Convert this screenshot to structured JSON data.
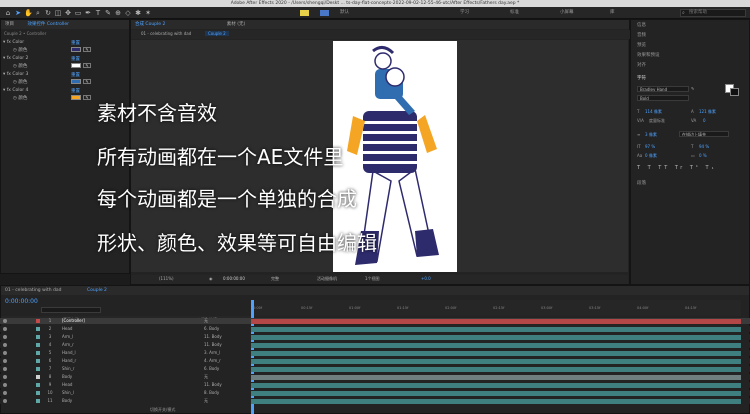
{
  "titlebar": {
    "text": "Adobe After Effects 2020 - /Users/shengqi/Deskt ... ts-day-flat-concepts-2022-09-02-12-55-46-utc/After Effects/Fathers day.aep *"
  },
  "toolbar": {
    "workspaces": [
      "默认",
      "学习",
      "标准",
      "小屏幕",
      "库"
    ],
    "active_workspace": "默认",
    "search_placeholder": "搜索帮助"
  },
  "effect_controls": {
    "tabs": [
      "项目",
      "效果控件 Controller"
    ],
    "breadcrumb": "Couple 2 • Controller",
    "groups": [
      {
        "name": "Color",
        "sub": "颜色",
        "reset": "重置",
        "color": "#2e2b6d"
      },
      {
        "name": "Color 2",
        "sub": "颜色",
        "reset": "重置",
        "color": "#ffffff"
      },
      {
        "name": "Color 3",
        "sub": "颜色",
        "reset": "重置",
        "color": "#2f6db0"
      },
      {
        "name": "Color 4",
        "sub": "颜色",
        "reset": "重置",
        "color": "#f5a524"
      }
    ]
  },
  "composition": {
    "tabs": [
      "合成 Couple 2",
      "素材 (无)"
    ],
    "breadcrumb": [
      "01 - celebrating with dad",
      "Couple 2"
    ],
    "zoom": "(111%)",
    "timecode": "0:00:00:00",
    "resolution": "完整",
    "camera": "活动摄像机",
    "views": "1个视图",
    "offset": "+0.0"
  },
  "overlay_lines": [
    "素材不含音效",
    "所有动画都在一个AE文件里",
    "每个动画都是一个单独的合成",
    "形状、颜色、效果等可自由编辑"
  ],
  "right_panels": {
    "items": [
      "信息",
      "音频",
      "预览",
      "效果和预设",
      "对齐"
    ],
    "character": {
      "title": "字符",
      "font": "Bradley Hand",
      "style": "Bold",
      "size": "114 像素",
      "leading": "121 像素",
      "kerning": "度量标准",
      "tracking": "0",
      "stroke": "3 像素",
      "stroke_mode": "在描边上填充",
      "vscale": "97 %",
      "hscale": "94 %",
      "baseline": "0 像素",
      "tsume": "0 %"
    },
    "paragraph": "段落"
  },
  "timeline": {
    "tabs": [
      "01 - celebrating with dad",
      "Couple 2"
    ],
    "timecode": "0:00:00:00",
    "col_source": "图层名称",
    "col_parent": "父级和链接",
    "ruler_ticks": [
      "0:00f",
      "00:15f",
      "01:00f",
      "01:15f",
      "02:00f",
      "02:15f",
      "03:00f",
      "03:15f",
      "04:00f",
      "04:15f"
    ],
    "footer": "切换开关/模式",
    "layers": [
      {
        "num": "1",
        "name": "[Controller]",
        "parent": "无",
        "color": "#c24a4a",
        "bar": "#b34747"
      },
      {
        "num": "2",
        "name": "Head",
        "parent": "6. Body",
        "color": "#5fa8a8",
        "bar": "#3f7f7f"
      },
      {
        "num": "3",
        "name": "Arm_l",
        "parent": "11. Body",
        "color": "#5fa8a8",
        "bar": "#3f7f7f"
      },
      {
        "num": "4",
        "name": "Arm_r",
        "parent": "11. Body",
        "color": "#5fa8a8",
        "bar": "#3f7f7f"
      },
      {
        "num": "5",
        "name": "Hand_l",
        "parent": "3. Arm_l",
        "color": "#5fa8a8",
        "bar": "#3f7f7f"
      },
      {
        "num": "6",
        "name": "Hand_r",
        "parent": "4. Arm_r",
        "color": "#5fa8a8",
        "bar": "#3f7f7f"
      },
      {
        "num": "7",
        "name": "Shin_r",
        "parent": "6. Body",
        "color": "#5fa8a8",
        "bar": "#3f7f7f"
      },
      {
        "num": "8",
        "name": "Body",
        "parent": "无",
        "color": "#cfcfcf",
        "bar": "#6f7f7f"
      },
      {
        "num": "9",
        "name": "Head",
        "parent": "11. Body",
        "color": "#5fa8a8",
        "bar": "#3f7f7f"
      },
      {
        "num": "10",
        "name": "Shin_l",
        "parent": "8. Body",
        "color": "#5fa8a8",
        "bar": "#3f7f7f"
      },
      {
        "num": "11",
        "name": "Body",
        "parent": "无",
        "color": "#5fa8a8",
        "bar": "#3f7f7f"
      }
    ]
  }
}
